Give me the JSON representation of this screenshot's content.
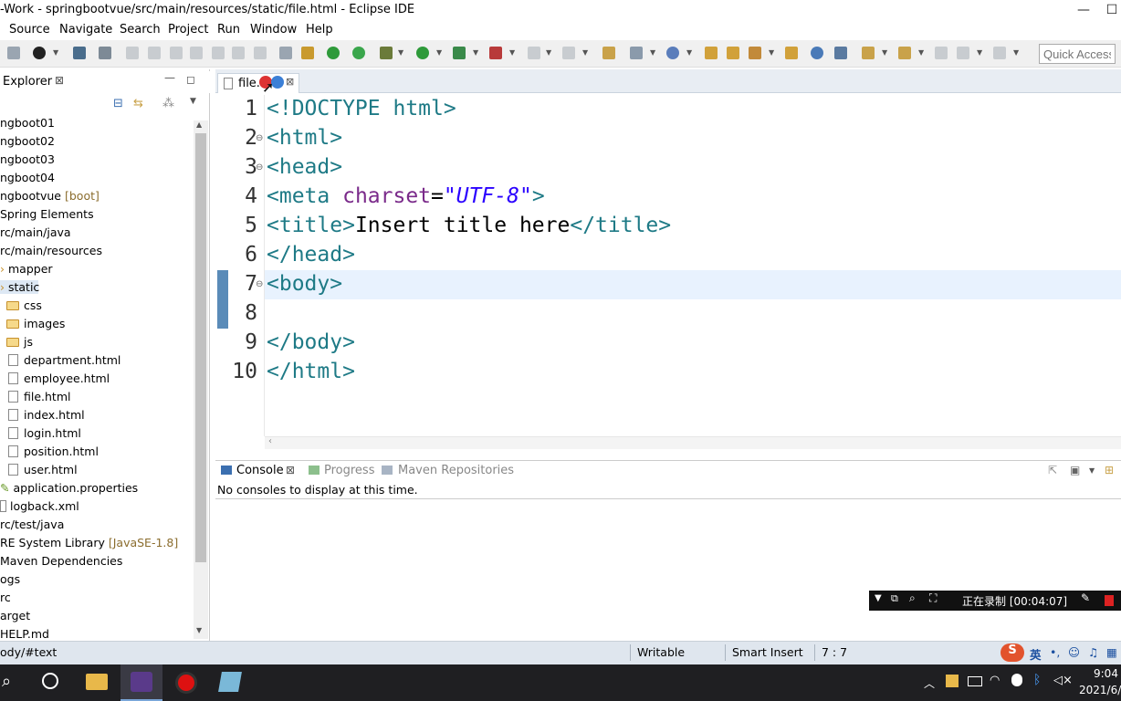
{
  "window": {
    "title": "-Work - springbootvue/src/main/resources/static/file.html - Eclipse IDE",
    "minimize": "—",
    "maximize": "☐"
  },
  "menu": [
    "Source",
    "Navigate",
    "Search",
    "Project",
    "Run",
    "Window",
    "Help"
  ],
  "toolbar": {
    "quick_access_placeholder": "Quick Access"
  },
  "explorer": {
    "tab_label": "Explorer",
    "items": [
      {
        "text": "ngboot01"
      },
      {
        "text": "ngboot02"
      },
      {
        "text": "ngboot03"
      },
      {
        "text": "ngboot04"
      },
      {
        "text": "ngbootvue",
        "decoration": "[boot]"
      },
      {
        "text": "Spring Elements"
      },
      {
        "text": "rc/main/java"
      },
      {
        "text": "rc/main/resources"
      },
      {
        "text": "mapper"
      },
      {
        "text": "static"
      },
      {
        "text": "css"
      },
      {
        "text": "images"
      },
      {
        "text": "js"
      },
      {
        "text": "department.html"
      },
      {
        "text": "employee.html"
      },
      {
        "text": "file.html"
      },
      {
        "text": "index.html"
      },
      {
        "text": "login.html"
      },
      {
        "text": "position.html"
      },
      {
        "text": "user.html"
      },
      {
        "text": "application.properties"
      },
      {
        "text": "logback.xml"
      },
      {
        "text": "rc/test/java"
      },
      {
        "text": "RE System Library",
        "decoration": "[JavaSE-1.8]"
      },
      {
        "text": "Maven Dependencies"
      },
      {
        "text": "ogs"
      },
      {
        "text": "rc"
      },
      {
        "text": "arget"
      },
      {
        "text": "HELP.md"
      }
    ]
  },
  "editor": {
    "tab_label": "file.h",
    "line_numbers": [
      "1",
      "2",
      "3",
      "4",
      "5",
      "6",
      "7",
      "8",
      "9",
      "10"
    ],
    "lines": [
      "<!DOCTYPE html>",
      "<html>",
      "<head>",
      "<meta charset=\"UTF-8\">",
      "<title>Insert title here</title>",
      "</head>",
      "<body>",
      "",
      "</body>",
      "</html>"
    ]
  },
  "console": {
    "tabs": [
      "Console",
      "Progress",
      "Maven Repositories"
    ],
    "message": "No consoles to display at this time."
  },
  "status": {
    "path": "ody/#text",
    "writable": "Writable",
    "insert_mode": "Smart Insert",
    "position": "7 : 7"
  },
  "recording": {
    "text": "正在录制 [00:04:07]"
  },
  "ime": {
    "lang": "英"
  },
  "taskbar": {
    "time": "9:04",
    "date": "2021/6/"
  }
}
